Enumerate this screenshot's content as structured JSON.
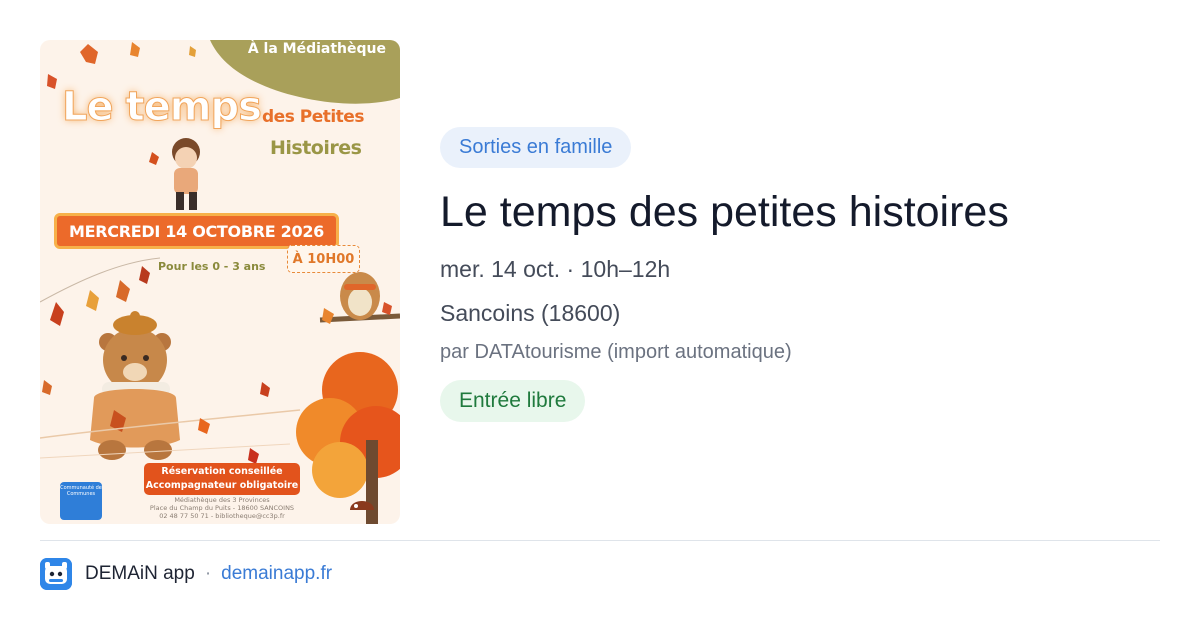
{
  "poster": {
    "venue": "À la Médiathèque",
    "title_line1": "Le temps",
    "title_line2": "des Petites",
    "title_line3": "Histoires",
    "date": "MERCREDI 14 OCTOBRE 2026",
    "age": "Pour les 0 - 3 ans",
    "time": "À 10H00",
    "reservation_1": "Réservation conseillée",
    "reservation_2": "Accompagnateur obligatoire",
    "address_1": "Médiathèque des 3 Provinces",
    "address_2": "Place du Champ du Puits - 18600 SANCOINS",
    "address_3": "02 48 77 50 71 - bibliotheque@cc3p.fr",
    "logo_text": "Communauté de Communes"
  },
  "event": {
    "category": "Sorties en famille",
    "title": "Le temps des petites histoires",
    "datetime": "mer. 14 oct. · 10h–12h",
    "location": "Sancoins (18600)",
    "source": "par DATAtourisme (import automatique)",
    "price": "Entrée libre"
  },
  "footer": {
    "app_name": "DEMAiN app",
    "separator": "·",
    "link": "demainapp.fr"
  },
  "colors": {
    "tag_bg": "#eaf1fb",
    "tag_text": "#3a7bd5",
    "badge_bg": "#e8f7ec",
    "badge_text": "#1f7a3d",
    "link": "#3a7bd5",
    "app_icon": "#2f86e8"
  }
}
